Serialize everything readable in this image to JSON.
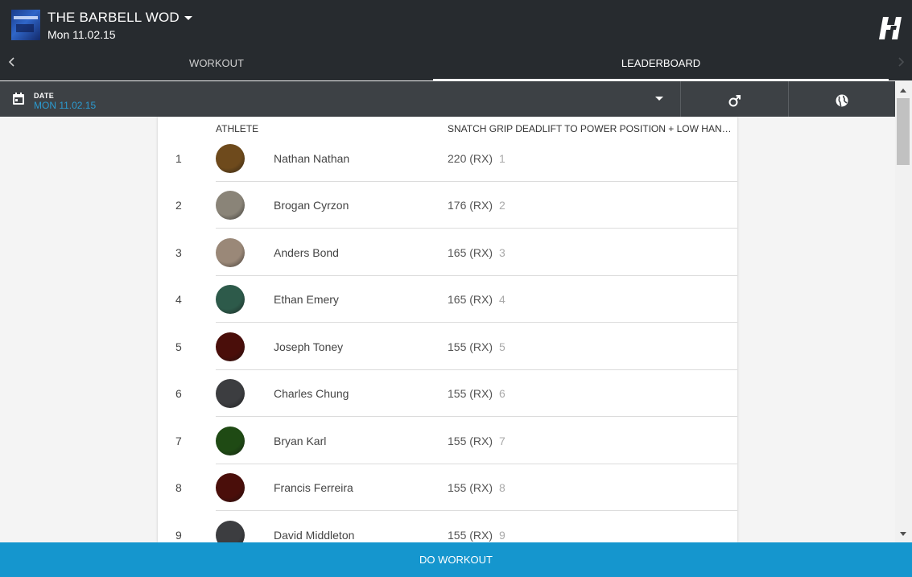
{
  "header": {
    "gym_name": "THE BARBELL WOD",
    "gym_date": "Mon 11.02.15"
  },
  "tabs": {
    "workout": "WORKOUT",
    "leaderboard": "LEADERBOARD"
  },
  "filter": {
    "date_label": "DATE",
    "date_value": "MON 11.02.15"
  },
  "leaderboard": {
    "col_athlete": "ATHLETE",
    "col_workout": "SNATCH GRIP DEADLIFT TO POWER POSITION + LOW HANG SNATCH",
    "rows": [
      {
        "rank": "1",
        "name": "Nathan Nathan",
        "score": "220 (RX)",
        "score_rank": "1",
        "avatar_color": "#6e4a1c"
      },
      {
        "rank": "2",
        "name": "Brogan Cyrzon",
        "score": "176 (RX)",
        "score_rank": "2",
        "avatar_color": "#8a8478"
      },
      {
        "rank": "3",
        "name": "Anders Bond",
        "score": "165 (RX)",
        "score_rank": "3",
        "avatar_color": "#9a8878"
      },
      {
        "rank": "4",
        "name": "Ethan Emery",
        "score": "165 (RX)",
        "score_rank": "4",
        "avatar_color": "#2d5a4a"
      },
      {
        "rank": "5",
        "name": "Joseph Toney",
        "score": "155 (RX)",
        "score_rank": "5",
        "avatar_color": "#4a0e0a"
      },
      {
        "rank": "6",
        "name": "Charles Chung",
        "score": "155 (RX)",
        "score_rank": "6",
        "avatar_color": "#3c3d40"
      },
      {
        "rank": "7",
        "name": "Bryan Karl",
        "score": "155 (RX)",
        "score_rank": "7",
        "avatar_color": "#1f4a14"
      },
      {
        "rank": "8",
        "name": "Francis Ferreira",
        "score": "155 (RX)",
        "score_rank": "8",
        "avatar_color": "#4a0e0a"
      },
      {
        "rank": "9",
        "name": "David Middleton",
        "score": "155 (RX)",
        "score_rank": "9",
        "avatar_color": "#3c3d40"
      }
    ]
  },
  "footer": {
    "cta_label": "DO WORKOUT"
  },
  "colors": {
    "topbar": "#272b2f",
    "filterbar": "#3d4145",
    "accent": "#1596ce",
    "date_accent": "#2b9bd1"
  },
  "icons": {
    "logo": "gym-logo",
    "dropdown": "caret-down-icon",
    "brand": "brand-h-icon",
    "calendar": "calendar-icon",
    "gender": "male-symbol-icon",
    "global": "globe-icon"
  }
}
